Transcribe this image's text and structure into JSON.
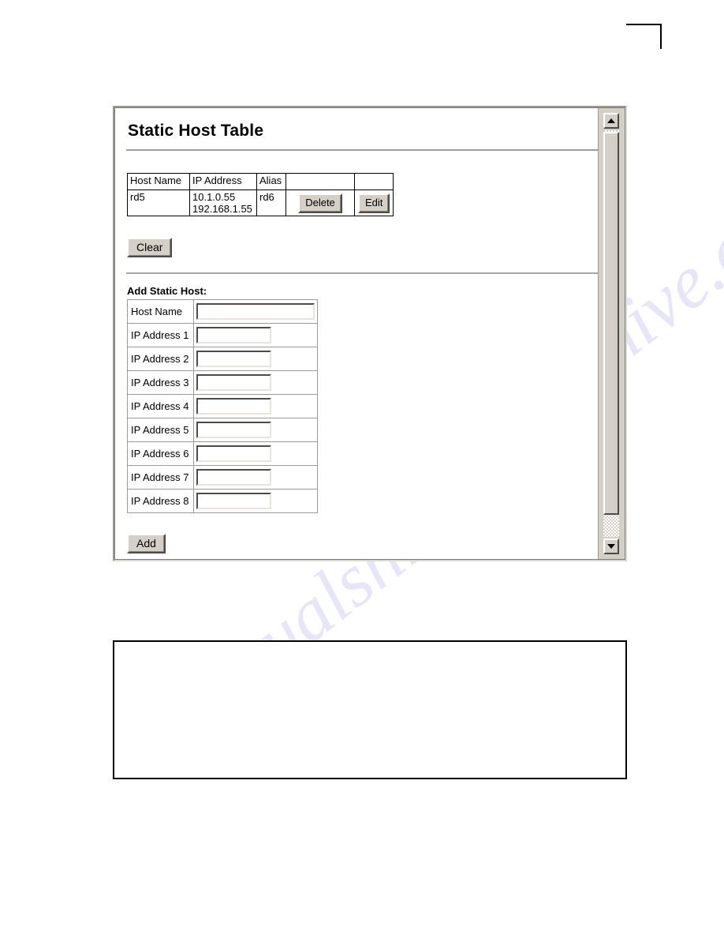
{
  "panel": {
    "title": "Static Host Table",
    "host_table": {
      "headers": [
        "Host Name",
        "IP Address",
        "Alias",
        "",
        ""
      ],
      "rows": [
        {
          "host_name": "rd5",
          "ip_address_line1": "10.1.0.55",
          "ip_address_line2": "192.168.1.55",
          "alias": "rd6",
          "delete_label": "Delete",
          "edit_label": "Edit"
        }
      ]
    },
    "clear_label": "Clear",
    "add_section_label": "Add Static Host:",
    "form_fields": [
      {
        "label": "Host Name",
        "value": "",
        "placeholder": ""
      },
      {
        "label": "IP Address 1",
        "value": "",
        "placeholder": ""
      },
      {
        "label": "IP Address 2",
        "value": "",
        "placeholder": ""
      },
      {
        "label": "IP Address 3",
        "value": "",
        "placeholder": ""
      },
      {
        "label": "IP Address 4",
        "value": "",
        "placeholder": ""
      },
      {
        "label": "IP Address 5",
        "value": "",
        "placeholder": ""
      },
      {
        "label": "IP Address 6",
        "value": "",
        "placeholder": ""
      },
      {
        "label": "IP Address 7",
        "value": "",
        "placeholder": ""
      },
      {
        "label": "IP Address 8",
        "value": "",
        "placeholder": ""
      }
    ],
    "add_label": "Add",
    "scrollbar": {
      "up_icon": "triangle-up-icon",
      "down_icon": "triangle-down-icon"
    }
  },
  "watermark": {
    "line1": "manualshive.com",
    "line2": "manualshive.com"
  },
  "colors": {
    "button_face": "#d4d0c8",
    "page_background": "#ffffff",
    "rule": "#9d9d9d",
    "border": "#000000"
  }
}
